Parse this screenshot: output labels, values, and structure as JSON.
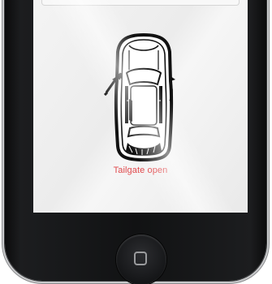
{
  "device": {
    "screen": {
      "car_icon": "car-top-view-icon",
      "tailgate_arrow_icon": "door-open-arrow-icon",
      "status_text": "Tailgate open",
      "status_color": "#e0494c"
    },
    "home_button_icon": "home-square-icon"
  }
}
